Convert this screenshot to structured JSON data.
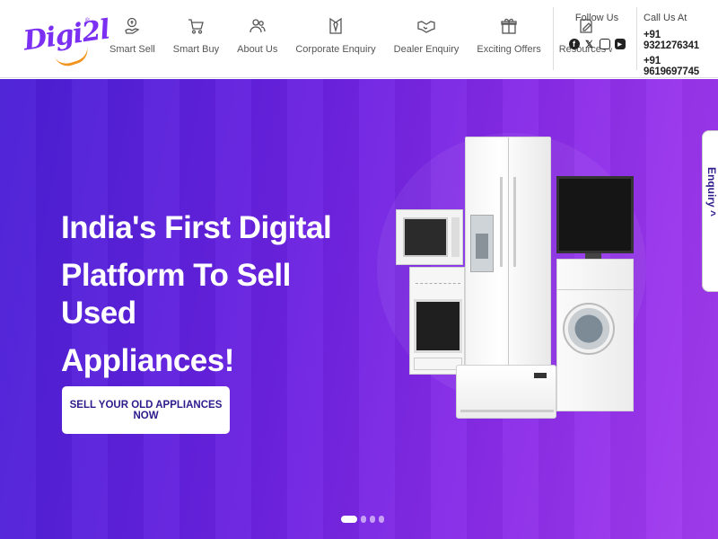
{
  "brand": {
    "logo_text": "Digi2l",
    "reg_mark": "®"
  },
  "nav": {
    "items": [
      {
        "label": "Smart Sell",
        "icon": "sell-icon"
      },
      {
        "label": "Smart Buy",
        "icon": "cart-icon"
      },
      {
        "label": "About Us",
        "icon": "people-icon"
      },
      {
        "label": "Corporate Enquiry",
        "icon": "tie-icon"
      },
      {
        "label": "Dealer Enquiry",
        "icon": "handshake-icon"
      },
      {
        "label": "Exciting Offers",
        "icon": "gift-icon"
      },
      {
        "label": "Resources",
        "icon": "edit-icon",
        "has_dropdown": true
      }
    ]
  },
  "follow": {
    "title": "Follow Us",
    "social": [
      "facebook-icon",
      "twitter-icon",
      "instagram-icon",
      "youtube-icon"
    ]
  },
  "call": {
    "title": "Call Us At",
    "phones": [
      "+91 9321276341",
      "+91 9619697745"
    ]
  },
  "hero": {
    "title_lines": [
      "India's First Digital",
      "Platform To Sell Used",
      "Appliances!"
    ],
    "cta_label": "SELL YOUR OLD APPLIANCES NOW"
  },
  "enquiry": {
    "label": "Enquiry ^"
  },
  "carousel": {
    "slide_count": 4,
    "active_index": 0
  },
  "colors": {
    "brand": "#7b2ff2",
    "accent": "#f0941f",
    "hero_start": "#4a1fd6",
    "hero_end": "#a33cef",
    "cta_text": "#2d1b8c"
  }
}
